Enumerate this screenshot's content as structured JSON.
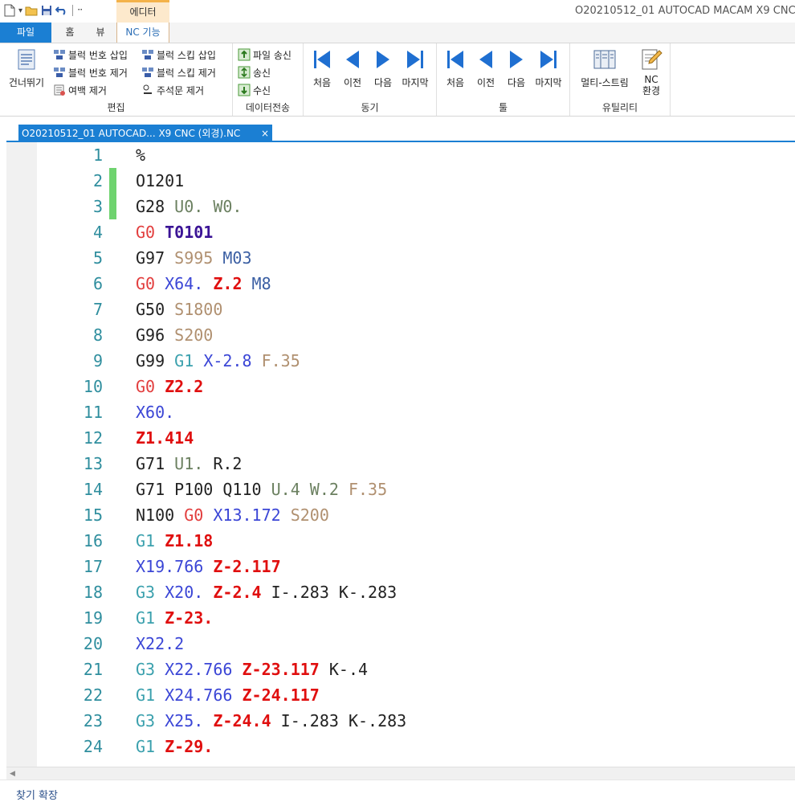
{
  "titlebar": {
    "context_tab": "에디터",
    "window_title": "O20210512_01 AUTOCAD MACAM X9 CNC ("
  },
  "tabs": {
    "file": "파일",
    "home": "홈",
    "view": "뷰",
    "nc": "NC 기능"
  },
  "ribbon": {
    "edit": {
      "label": "편집",
      "skip": "건너뛰기",
      "insert_block_number": "블럭 번호 삽입",
      "remove_block_number": "블럭 번호 제거",
      "remove_space": "여백 제거",
      "insert_block_skip": "블럭 스킵 삽입",
      "remove_block_skip": "블럭 스킵 제거",
      "remove_comment": "주석문 제거"
    },
    "data_transfer": {
      "label": "데이터전송",
      "send_file": "파일 송신",
      "send": "송신",
      "receive": "수신"
    },
    "sync": {
      "label": "동기",
      "first": "처음",
      "prev": "이전",
      "next": "다음",
      "last": "마지막"
    },
    "tool": {
      "label": "툴",
      "first": "처음",
      "prev": "이전",
      "next": "다음",
      "last": "마지막"
    },
    "utility": {
      "label": "유틸리티",
      "multi_stream": "멀티-스트림",
      "nc_env_1": "NC",
      "nc_env_2": "환경"
    }
  },
  "document_tab": {
    "title": "O20210512_01 AUTOCAD... X9 CNC (외경).NC",
    "close": "×"
  },
  "editor": {
    "lines": [
      {
        "n": "1",
        "tokens": [
          [
            "p",
            "%"
          ]
        ]
      },
      {
        "n": "2",
        "tokens": [
          [
            "g",
            "O1201"
          ]
        ]
      },
      {
        "n": "3",
        "tokens": [
          [
            "g",
            "G28"
          ],
          [
            "p",
            " "
          ],
          [
            "u",
            "U0."
          ],
          [
            "p",
            " "
          ],
          [
            "u",
            "W0."
          ]
        ]
      },
      {
        "n": "4",
        "tokens": [
          [
            "g0",
            "G0"
          ],
          [
            "p",
            " "
          ],
          [
            "t",
            "T0101"
          ]
        ]
      },
      {
        "n": "5",
        "tokens": [
          [
            "g",
            "G97"
          ],
          [
            "p",
            " "
          ],
          [
            "s",
            "S995"
          ],
          [
            "p",
            " "
          ],
          [
            "m",
            "M03"
          ]
        ]
      },
      {
        "n": "6",
        "tokens": [
          [
            "g0",
            "G0"
          ],
          [
            "p",
            " "
          ],
          [
            "x",
            "X64."
          ],
          [
            "p",
            " "
          ],
          [
            "z",
            "Z.2"
          ],
          [
            "p",
            " "
          ],
          [
            "m",
            "M8"
          ]
        ]
      },
      {
        "n": "7",
        "tokens": [
          [
            "g",
            "G50"
          ],
          [
            "p",
            " "
          ],
          [
            "s",
            "S1800"
          ]
        ]
      },
      {
        "n": "8",
        "tokens": [
          [
            "g",
            "G96"
          ],
          [
            "p",
            " "
          ],
          [
            "s",
            "S200"
          ]
        ]
      },
      {
        "n": "9",
        "tokens": [
          [
            "g",
            "G99"
          ],
          [
            "p",
            " "
          ],
          [
            "gt",
            "G1"
          ],
          [
            "p",
            " "
          ],
          [
            "x",
            "X-2.8"
          ],
          [
            "p",
            " "
          ],
          [
            "f",
            "F.35"
          ]
        ]
      },
      {
        "n": "10",
        "tokens": [
          [
            "g0",
            "G0"
          ],
          [
            "p",
            " "
          ],
          [
            "z",
            "Z2.2"
          ]
        ]
      },
      {
        "n": "11",
        "tokens": [
          [
            "x",
            "X60."
          ]
        ]
      },
      {
        "n": "12",
        "tokens": [
          [
            "z",
            "Z1.414"
          ]
        ]
      },
      {
        "n": "13",
        "tokens": [
          [
            "g",
            "G71"
          ],
          [
            "p",
            " "
          ],
          [
            "u",
            "U1."
          ],
          [
            "p",
            " "
          ],
          [
            "p",
            "R.2"
          ]
        ]
      },
      {
        "n": "14",
        "tokens": [
          [
            "g",
            "G71"
          ],
          [
            "p",
            " "
          ],
          [
            "p",
            "P100"
          ],
          [
            "p",
            " "
          ],
          [
            "p",
            "Q110"
          ],
          [
            "p",
            " "
          ],
          [
            "u",
            "U.4"
          ],
          [
            "p",
            " "
          ],
          [
            "u",
            "W.2"
          ],
          [
            "p",
            " "
          ],
          [
            "f",
            "F.35"
          ]
        ]
      },
      {
        "n": "15",
        "tokens": [
          [
            "p",
            "N100"
          ],
          [
            "p",
            " "
          ],
          [
            "g0",
            "G0"
          ],
          [
            "p",
            " "
          ],
          [
            "x",
            "X13.172"
          ],
          [
            "p",
            " "
          ],
          [
            "s",
            "S200"
          ]
        ]
      },
      {
        "n": "16",
        "tokens": [
          [
            "gt",
            "G1"
          ],
          [
            "p",
            " "
          ],
          [
            "z",
            "Z1.18"
          ]
        ]
      },
      {
        "n": "17",
        "tokens": [
          [
            "x",
            "X19.766"
          ],
          [
            "p",
            " "
          ],
          [
            "z",
            "Z-2.117"
          ]
        ]
      },
      {
        "n": "18",
        "tokens": [
          [
            "gt",
            "G3"
          ],
          [
            "p",
            " "
          ],
          [
            "x",
            "X20."
          ],
          [
            "p",
            " "
          ],
          [
            "z",
            "Z-2.4"
          ],
          [
            "p",
            " "
          ],
          [
            "p",
            "I-.283"
          ],
          [
            "p",
            " "
          ],
          [
            "p",
            "K-.283"
          ]
        ]
      },
      {
        "n": "19",
        "tokens": [
          [
            "gt",
            "G1"
          ],
          [
            "p",
            " "
          ],
          [
            "z",
            "Z-23."
          ]
        ]
      },
      {
        "n": "20",
        "tokens": [
          [
            "x",
            "X22.2"
          ]
        ]
      },
      {
        "n": "21",
        "tokens": [
          [
            "gt",
            "G3"
          ],
          [
            "p",
            " "
          ],
          [
            "x",
            "X22.766"
          ],
          [
            "p",
            " "
          ],
          [
            "z",
            "Z-23.117"
          ],
          [
            "p",
            " "
          ],
          [
            "p",
            "K-.4"
          ]
        ]
      },
      {
        "n": "22",
        "tokens": [
          [
            "gt",
            "G1"
          ],
          [
            "p",
            " "
          ],
          [
            "x",
            "X24.766"
          ],
          [
            "p",
            " "
          ],
          [
            "z",
            "Z-24.117"
          ]
        ]
      },
      {
        "n": "23",
        "tokens": [
          [
            "gt",
            "G3"
          ],
          [
            "p",
            " "
          ],
          [
            "x",
            "X25."
          ],
          [
            "p",
            " "
          ],
          [
            "z",
            "Z-24.4"
          ],
          [
            "p",
            " "
          ],
          [
            "p",
            "I-.283"
          ],
          [
            "p",
            " "
          ],
          [
            "p",
            "K-.283"
          ]
        ]
      },
      {
        "n": "24",
        "tokens": [
          [
            "gt",
            "G1"
          ],
          [
            "p",
            " "
          ],
          [
            "z",
            "Z-29."
          ]
        ]
      }
    ],
    "changed_lines": [
      2,
      3
    ]
  },
  "status": {
    "text": "찾기 확장"
  }
}
